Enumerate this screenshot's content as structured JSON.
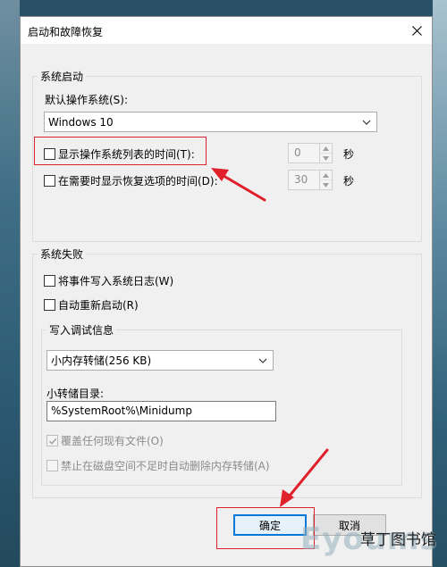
{
  "dialog": {
    "title": "启动和故障恢复",
    "close_icon": "close-icon"
  },
  "system_startup": {
    "legend": "系统启动",
    "default_os_label": "默认操作系统(S):",
    "default_os_value": "Windows 10",
    "show_os_list_label": "显示操作系统列表的时间(T):",
    "show_os_list_checked": false,
    "show_os_list_value": "0",
    "show_recovery_label": "在需要时显示恢复选项的时间(D):",
    "show_recovery_checked": false,
    "show_recovery_value": "30",
    "seconds_unit": "秒"
  },
  "system_failure": {
    "legend": "系统失败",
    "write_log_label": "将事件写入系统日志(W)",
    "write_log_checked": false,
    "auto_restart_label": "自动重新启动(R)",
    "auto_restart_checked": false,
    "debug_info": {
      "legend": "写入调试信息",
      "dump_type_value": "小内存转储(256 KB)",
      "dump_dir_label": "小转储目录:",
      "dump_dir_value": "%SystemRoot%\\Minidump",
      "overwrite_label": "覆盖任何现有文件(O)",
      "overwrite_checked": true,
      "disable_auto_delete_label": "禁止在磁盘空间不足时自动删除内存转储(A)",
      "disable_auto_delete_checked": false
    }
  },
  "buttons": {
    "ok": "确定",
    "cancel": "取消"
  },
  "watermark": {
    "logo": "Eyoums",
    "text": "草丁图书馆"
  },
  "colors": {
    "annotation": "#e0202a",
    "focus": "#0078d7"
  }
}
